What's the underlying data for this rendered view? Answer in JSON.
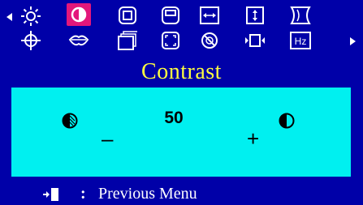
{
  "menu": {
    "title": "Contrast",
    "selected_icon": "contrast-icon",
    "icons_row1": [
      "brightness-icon",
      "contrast-icon",
      "position-icon",
      "size-icon",
      "horizontal-size-icon",
      "vertical-size-icon",
      "pincushion-icon"
    ],
    "icons_row2": [
      "tilt-icon",
      "color-icon",
      "recall-icon",
      "zoom-icon",
      "degauss-icon",
      "horizontal-position-icon",
      "frequency-icon"
    ],
    "frequency_label": "Hz"
  },
  "adjustment": {
    "value": "50",
    "decrease_symbol": "–",
    "increase_symbol": "+",
    "level_percent": 50
  },
  "footer": {
    "colon": ":",
    "label": "Previous Menu"
  },
  "colors": {
    "background": "#0000a8",
    "panel": "#00f0f0",
    "selected": "#e3177b",
    "title": "#ffff40",
    "icon": "#ffffff"
  }
}
